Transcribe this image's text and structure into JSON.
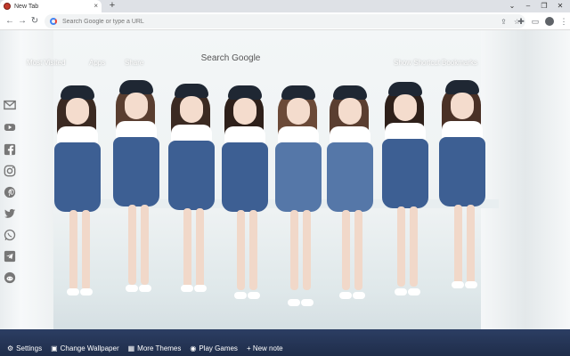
{
  "tab": {
    "title": "New Tab",
    "close": "×",
    "new_tab": "+"
  },
  "window": {
    "minimize": "–",
    "restore": "❐",
    "close": "✕",
    "menu_arrow": "⌄"
  },
  "toolbar": {
    "back": "←",
    "forward": "→",
    "reload": "↻",
    "omnibox_placeholder": "Search Google or type a URL",
    "share": "⇪",
    "bookmark": "☆",
    "extensions": "✚",
    "sidebar": "▭",
    "menu": "⋮"
  },
  "links": {
    "most_visited": "Most Visited",
    "apps": "Apps",
    "share": "Share",
    "search_title": "Search Google",
    "show_shortcut": "Show Shortcut",
    "bookmarks": "Bookmarks"
  },
  "social": [
    "gmail-icon",
    "youtube-icon",
    "facebook-icon",
    "instagram-icon",
    "pinterest-icon",
    "twitter-icon",
    "whatsapp-icon",
    "telegram-icon",
    "reddit-icon"
  ],
  "bottom": {
    "settings": "Settings",
    "change_wallpaper": "Change Wallpaper",
    "more_themes": "More Themes",
    "play_games": "Play Games",
    "new_note": "+ New note"
  },
  "colors": {
    "accent": "#4285f4",
    "dress": "#3d5f93",
    "floor": "#1f2d4a"
  }
}
